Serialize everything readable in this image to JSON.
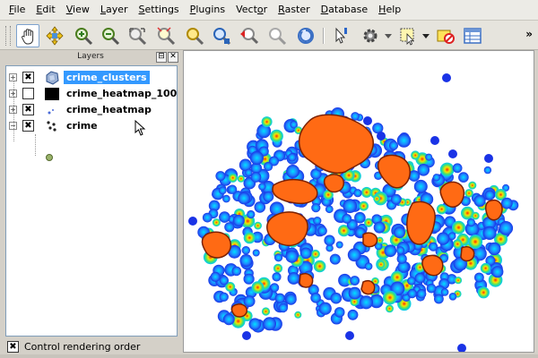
{
  "menu": [
    "File",
    "Edit",
    "View",
    "Layer",
    "Settings",
    "Plugins",
    "Vector",
    "Raster",
    "Database",
    "Help"
  ],
  "menu_accelerators": [
    "F",
    "E",
    "V",
    "L",
    "S",
    "P",
    "o",
    "R",
    "D",
    "H"
  ],
  "toolbar": {
    "tools": [
      "pan-icon",
      "pan-to-selection-icon",
      "zoom-in-icon",
      "zoom-out-icon",
      "zoom-full-icon",
      "zoom-to-selection-icon",
      "zoom-to-layer-icon",
      "zoom-native-icon",
      "zoom-last-icon",
      "zoom-next-icon",
      "refresh-icon",
      "identify-icon",
      "action-icon",
      "select-icon",
      "deselect-icon",
      "attribute-table-icon"
    ],
    "overflow": "»"
  },
  "layers_panel": {
    "title": "Layers",
    "float_button": "⊟",
    "close_button": "✕",
    "layers": [
      {
        "name": "crime_clusters",
        "visible": true,
        "selected": true,
        "expanded": false,
        "icon": "polygon-layer-icon"
      },
      {
        "name": "crime_heatmap_100",
        "visible": false,
        "selected": false,
        "expanded": false,
        "icon": "raster-black-icon"
      },
      {
        "name": "crime_heatmap",
        "visible": true,
        "selected": false,
        "expanded": false,
        "icon": "raster-layer-icon"
      },
      {
        "name": "crime",
        "visible": true,
        "selected": false,
        "expanded": true,
        "icon": "point-layer-icon"
      }
    ],
    "render_order": {
      "label": "Control rendering order",
      "checked": true
    }
  },
  "colors": {
    "heat_low": "#1a33e6",
    "heat_mid": "#00c8ff",
    "heat_high": "#f2e600",
    "cluster_fill": "#ff6a14",
    "cluster_stroke": "#7a2000",
    "selection": "#3399ff"
  }
}
